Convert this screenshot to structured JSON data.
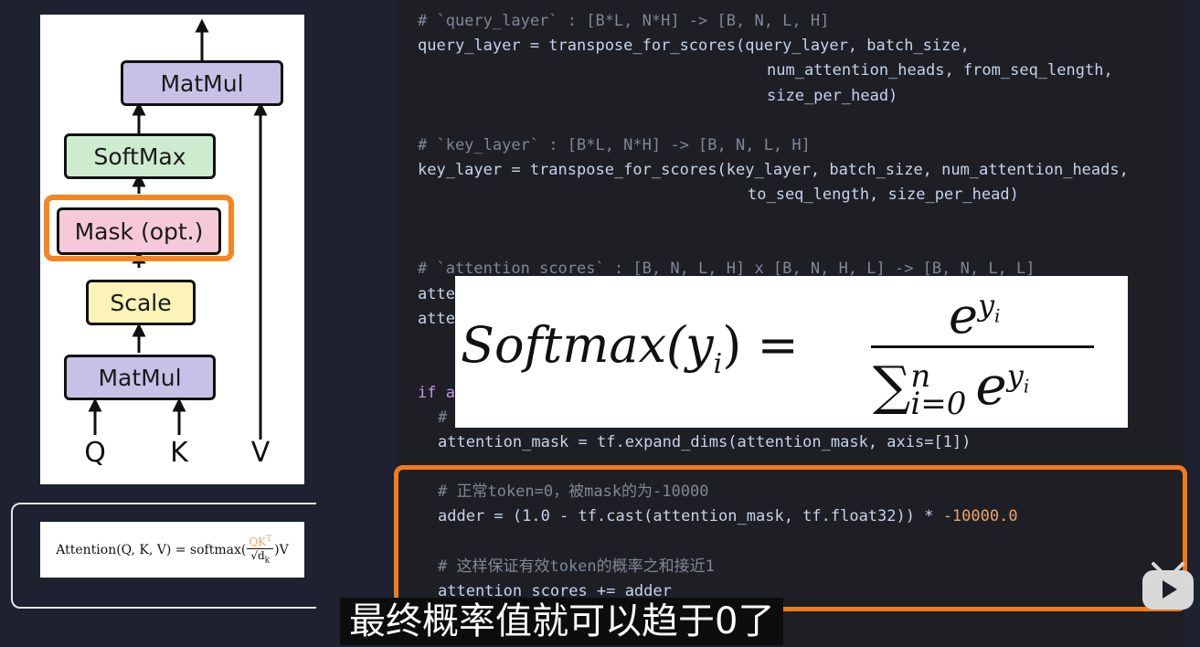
{
  "diagram": {
    "blocks": {
      "matmul_top": "MatMul",
      "softmax": "SoftMax",
      "mask": "Mask (opt.)",
      "scale": "Scale",
      "matmul_bottom": "MatMul"
    },
    "inputs": {
      "q": "Q",
      "k": "K",
      "v": "V"
    }
  },
  "formula": {
    "lhs": "Attention(Q, K, V) = softmax(",
    "num": "QK",
    "num_sup": "T",
    "den": "√d",
    "den_sub": "k",
    "rhs": ")V"
  },
  "code": {
    "l1": "# `query_layer` : [B*L, N*H] -> [B, N, L, H]",
    "l2": "query_layer = transpose_for_scores(query_layer, batch_size,",
    "l3": "num_attention_heads, from_seq_length,",
    "l4": "size_per_head)",
    "l5": "# `key_layer` : [B*L, N*H] -> [B, N, L, H]",
    "l6": "key_layer = transpose_for_scores(key_layer, batch_size, num_attention_heads,",
    "l7": "to_seq_length, size_per_head)",
    "l8": "# `attention_scores` : [B, N, L, H] x [B, N, H, L] -> [B, N, L, L]",
    "l9": "atte",
    "l10": "atte",
    "l11": "if a",
    "l12": "#",
    "l13": "attention_mask = tf.expand_dims(attention_mask, axis=[1])",
    "l14": "# 正常token=0，被mask的为-10000",
    "l15_a": "adder = (1.0 - tf.cast(attention_mask, tf.float32)) * ",
    "l15_b": "-10000.0",
    "l16": "# 这样保证有效token的概率之和接近1",
    "l17": "attention_scores += adder"
  },
  "softmax_formula": {
    "lhs": "Softmax(y",
    "lhs_sub": "i",
    "lhs_end": ") =",
    "num_base": "e",
    "num_exp": "y",
    "num_exp_sub": "i",
    "den_sum": "∑",
    "den_upper": "n",
    "den_lower": "i=0",
    "den_base": "e",
    "den_exp": "y",
    "den_exp_sub": "i"
  },
  "subtitle": "最终概率值就可以趋于0了",
  "colors": {
    "highlight": "#f27a1a",
    "code_bg": "#1d1f25",
    "page_bg": "#1d2130",
    "bili_pink": "#fb7299"
  },
  "icons": [
    "bilibili-tv-icon"
  ]
}
